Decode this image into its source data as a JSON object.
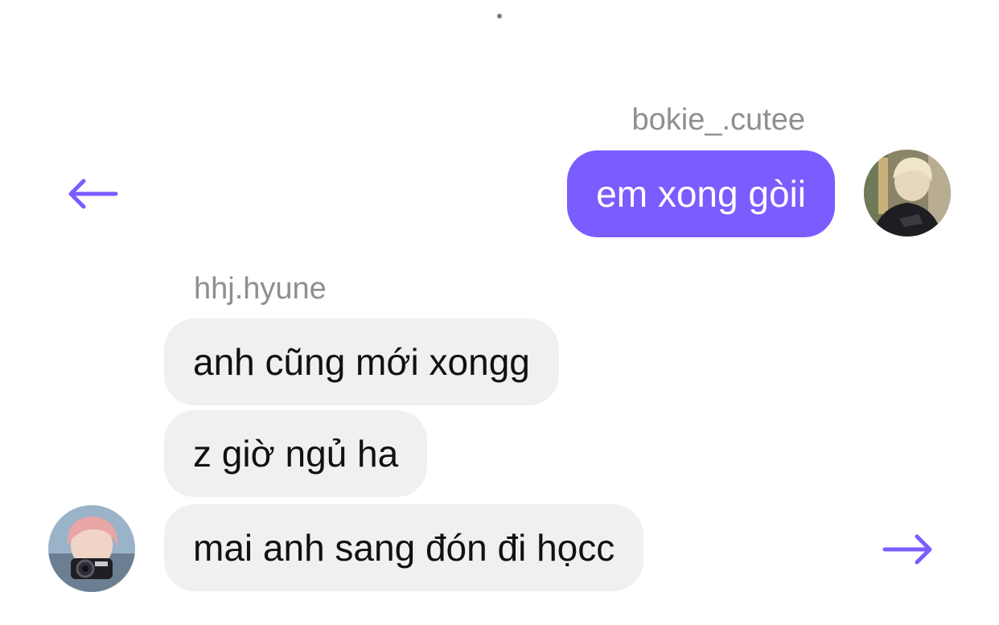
{
  "header": {
    "indicator": "top-dot"
  },
  "colors": {
    "accent": "#7b5cff",
    "sent_bubble": "#7b5cff",
    "received_bubble": "#f0f0f3",
    "username_text": "#8e8e93"
  },
  "conversation": {
    "sender": {
      "username": "bokie_.cutee",
      "messages": [
        "em xong gòii"
      ]
    },
    "receiver": {
      "username": "hhj.hyune",
      "messages": [
        "anh cũng mới xongg",
        "z giờ ngủ ha",
        "mai anh sang đón đi họcc"
      ]
    }
  },
  "navigation": {
    "back_icon": "arrow-left-icon",
    "forward_icon": "arrow-right-icon"
  }
}
